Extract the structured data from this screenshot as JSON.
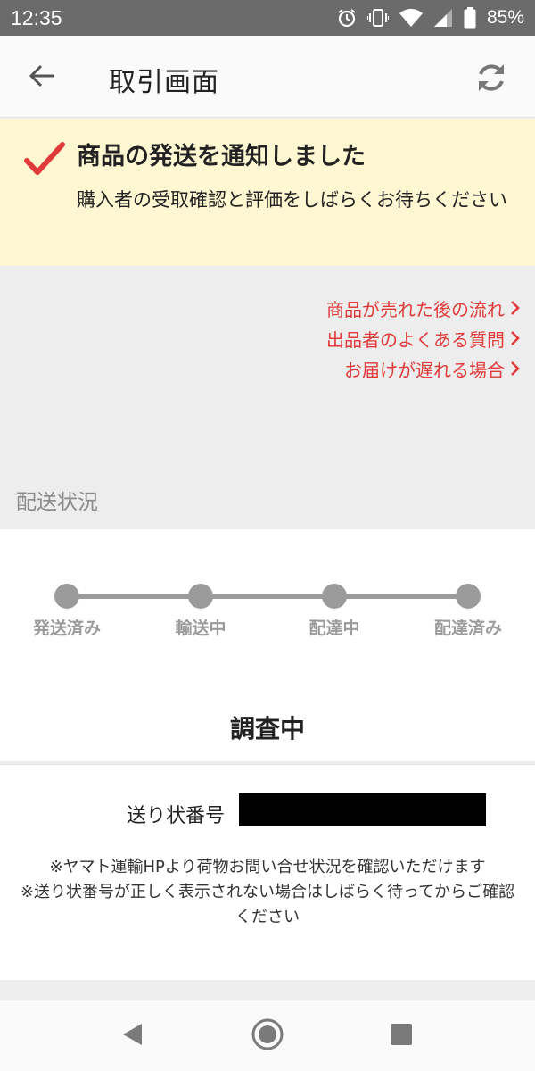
{
  "status_bar": {
    "time": "12:35",
    "battery_percent": "85%",
    "icons": [
      "alarm-icon",
      "vibrate-icon",
      "wifi-icon",
      "signal-icon",
      "battery-icon"
    ]
  },
  "header": {
    "title": "取引画面",
    "back_icon": "arrow-left-icon",
    "refresh_icon": "refresh-icon"
  },
  "notice": {
    "title": "商品の発送を通知しました",
    "subtitle": "購入者の受取確認と評価をしばらくお待ちください"
  },
  "help_links": [
    {
      "label": "商品が売れた後の流れ"
    },
    {
      "label": "出品者のよくある質問"
    },
    {
      "label": "お届けが遅れる場合"
    }
  ],
  "shipping": {
    "section_label": "配送状況",
    "steps": [
      {
        "label": "発送済み"
      },
      {
        "label": "輸送中"
      },
      {
        "label": "配達中"
      },
      {
        "label": "配達済み"
      }
    ],
    "status": "調査中",
    "tracking_label": "送り状番号",
    "notes": [
      "※ヤマト運輸HPより荷物お問い合せ状況を確認いただけます",
      "※送り状番号が正しく表示されない場合はしばらく待ってからご確認ください"
    ]
  },
  "colors": {
    "accent_red": "#e03a3a",
    "notice_bg": "#fff7d1",
    "step_gray": "#9b9b9b",
    "page_bg": "#ededed"
  },
  "nav_bar": {
    "icons": [
      "back-triangle-icon",
      "home-circle-icon",
      "recents-square-icon"
    ]
  }
}
